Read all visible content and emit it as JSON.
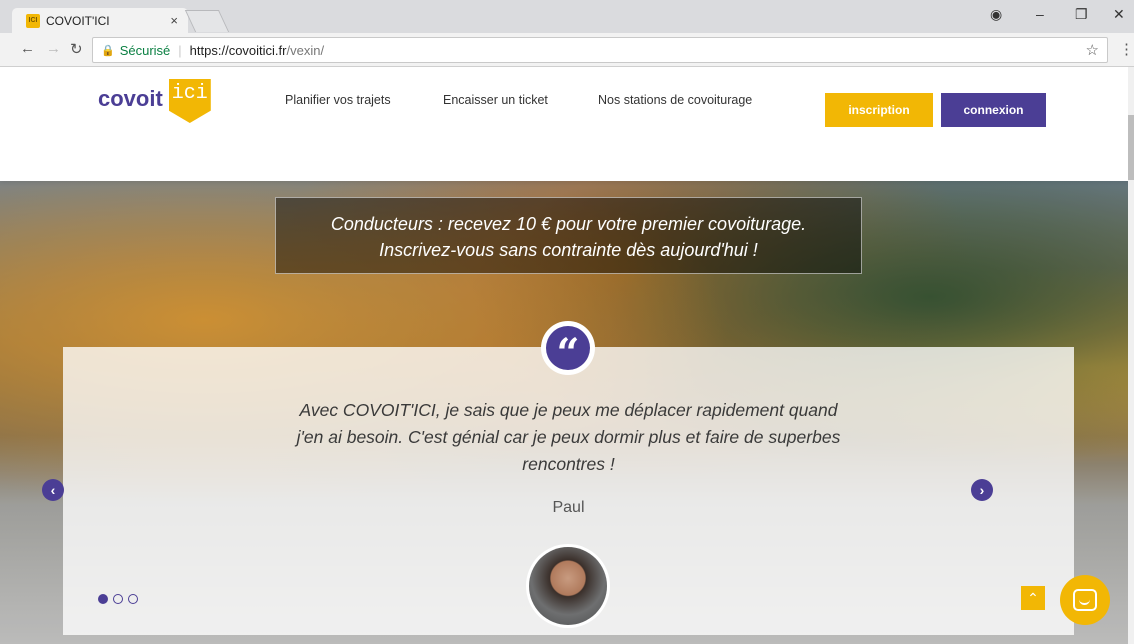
{
  "browser": {
    "tab_title": "COVOIT'ICI",
    "tab_favicon_text": "ICI",
    "tab_close": "×",
    "secure_label": "Sécurisé",
    "url_host": "https://covoitici.fr",
    "url_path": "/vexin/",
    "icons": {
      "back": "arrow-left",
      "forward": "arrow-right",
      "reload": "reload",
      "lock": "lock",
      "star": "star",
      "menu": "kebab",
      "account": "account",
      "minimize": "minimize",
      "restore": "restore",
      "close": "close"
    }
  },
  "header": {
    "logo_text": "covoit",
    "logo_badge": "ici",
    "nav": [
      "Planifier vos trajets",
      "Encaisser un ticket",
      "Nos stations de covoiturage"
    ],
    "signup_label": "inscription",
    "login_label": "connexion"
  },
  "hero": {
    "promo_line1": "Conducteurs : recevez 10 € pour votre premier covoiturage.",
    "promo_line2": "Inscrivez-vous sans contrainte dès aujourd'hui !"
  },
  "testimonial": {
    "quote": "Avec COVOIT'ICI, je sais que je peux me déplacer rapidement quand j'en ai besoin. C'est génial car je peux dormir plus et faire de superbes rencontres !",
    "author": "Paul",
    "slides": 3,
    "active_slide": 1
  },
  "colors": {
    "brand_yellow": "#f2b705",
    "brand_purple": "#4b3e95"
  }
}
